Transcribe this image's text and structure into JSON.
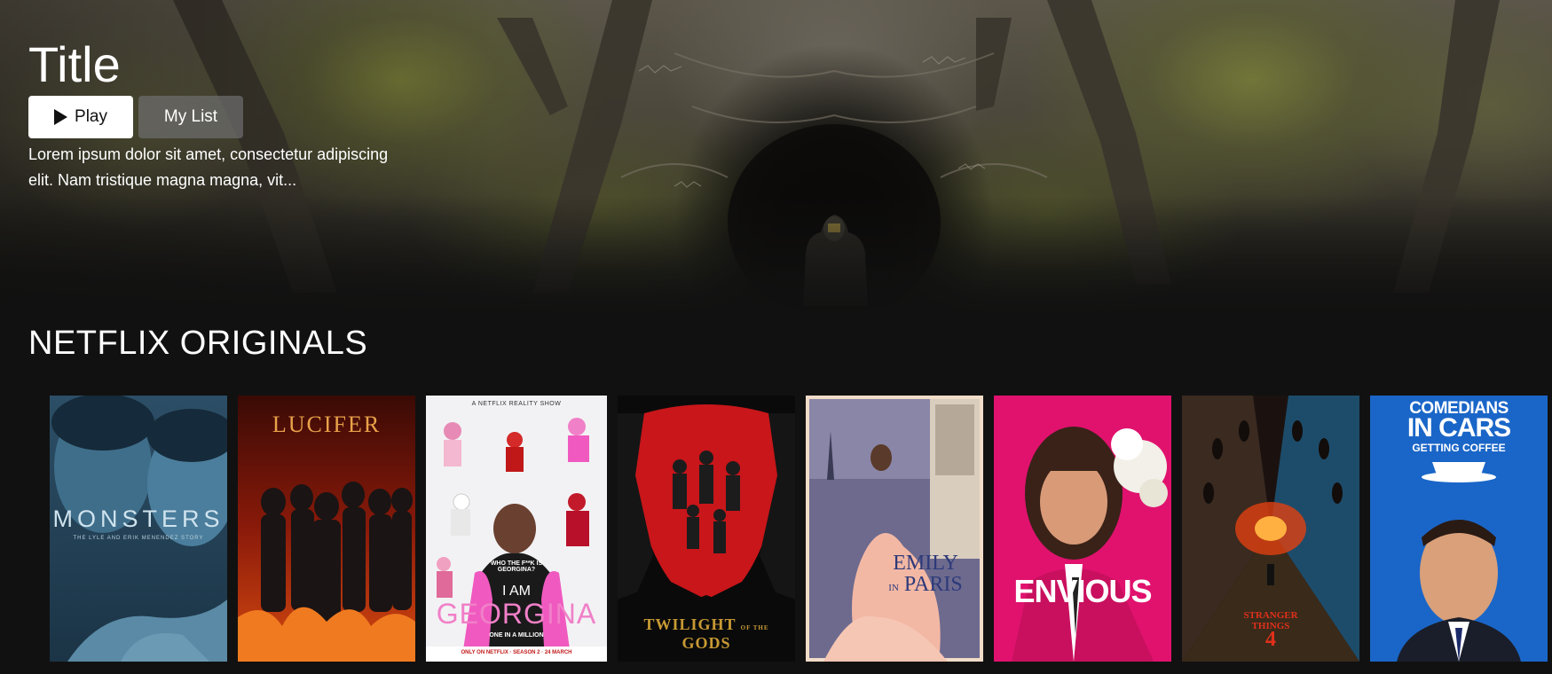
{
  "hero": {
    "title": "Title",
    "play_label": "Play",
    "mylist_label": "My List",
    "description": "Lorem ipsum dolor sit amet, consectetur adipiscing elit. Nam tristique magna magna, vit..."
  },
  "row": {
    "title": "NETFLIX ORIGINALS",
    "posters": [
      {
        "title": "MONSTERS",
        "subtitle": "THE LYLE AND ERIK MENENDEZ STORY"
      },
      {
        "title": "LUCIFER"
      },
      {
        "title_top": "I AM",
        "title": "GEORGINA",
        "tag": "A NETFLIX REALITY SHOW",
        "shirt": "WHO THE F**K IS GEORGINA?",
        "tagline": "ONE IN A MILLION",
        "footer": "ONLY ON NETFLIX · SEASON 2 · 24 MARCH"
      },
      {
        "title_a": "TWILIGHT",
        "title_small": "OF THE",
        "title_b": "GODS"
      },
      {
        "title_a": "EMILY",
        "title_small": "IN",
        "title_b": "PARIS"
      },
      {
        "title": "ENVIOUS"
      },
      {
        "title_a": "STRANGER",
        "title_b": "THINGS",
        "number": "4"
      },
      {
        "title_a": "COMEDIANS",
        "title_b": "IN CARS",
        "title_c": "GETTING COFFEE"
      }
    ]
  },
  "colors": {
    "background": "#111111",
    "play_button": "#ffffff",
    "mylist_button": "#6e6e6e"
  }
}
